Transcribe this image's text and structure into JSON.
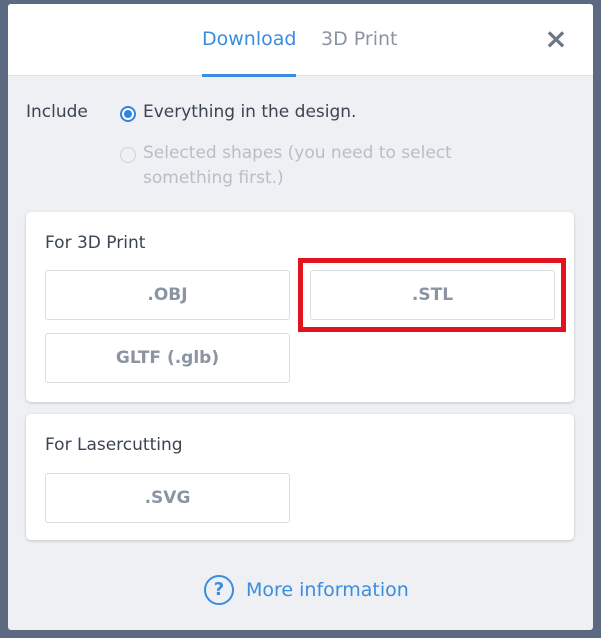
{
  "tabs": [
    {
      "label": "Download",
      "active": true
    },
    {
      "label": "3D Print",
      "active": false
    }
  ],
  "close_icon": "×",
  "include": {
    "label": "Include",
    "options": [
      {
        "label": "Everything in the design.",
        "selected": true,
        "enabled": true
      },
      {
        "label": "Selected shapes (you need to select something first.)",
        "selected": false,
        "enabled": false
      }
    ]
  },
  "sections": {
    "print3d": {
      "title": "For 3D Print",
      "buttons": [
        ".OBJ",
        ".STL",
        "GLTF (.glb)"
      ]
    },
    "laser": {
      "title": "For Lasercutting",
      "buttons": [
        ".SVG"
      ]
    }
  },
  "more_info": {
    "icon": "?",
    "label": "More information"
  },
  "colors": {
    "accent": "#3a8dde",
    "highlight": "#e3121c",
    "background": "#eef0f4"
  }
}
